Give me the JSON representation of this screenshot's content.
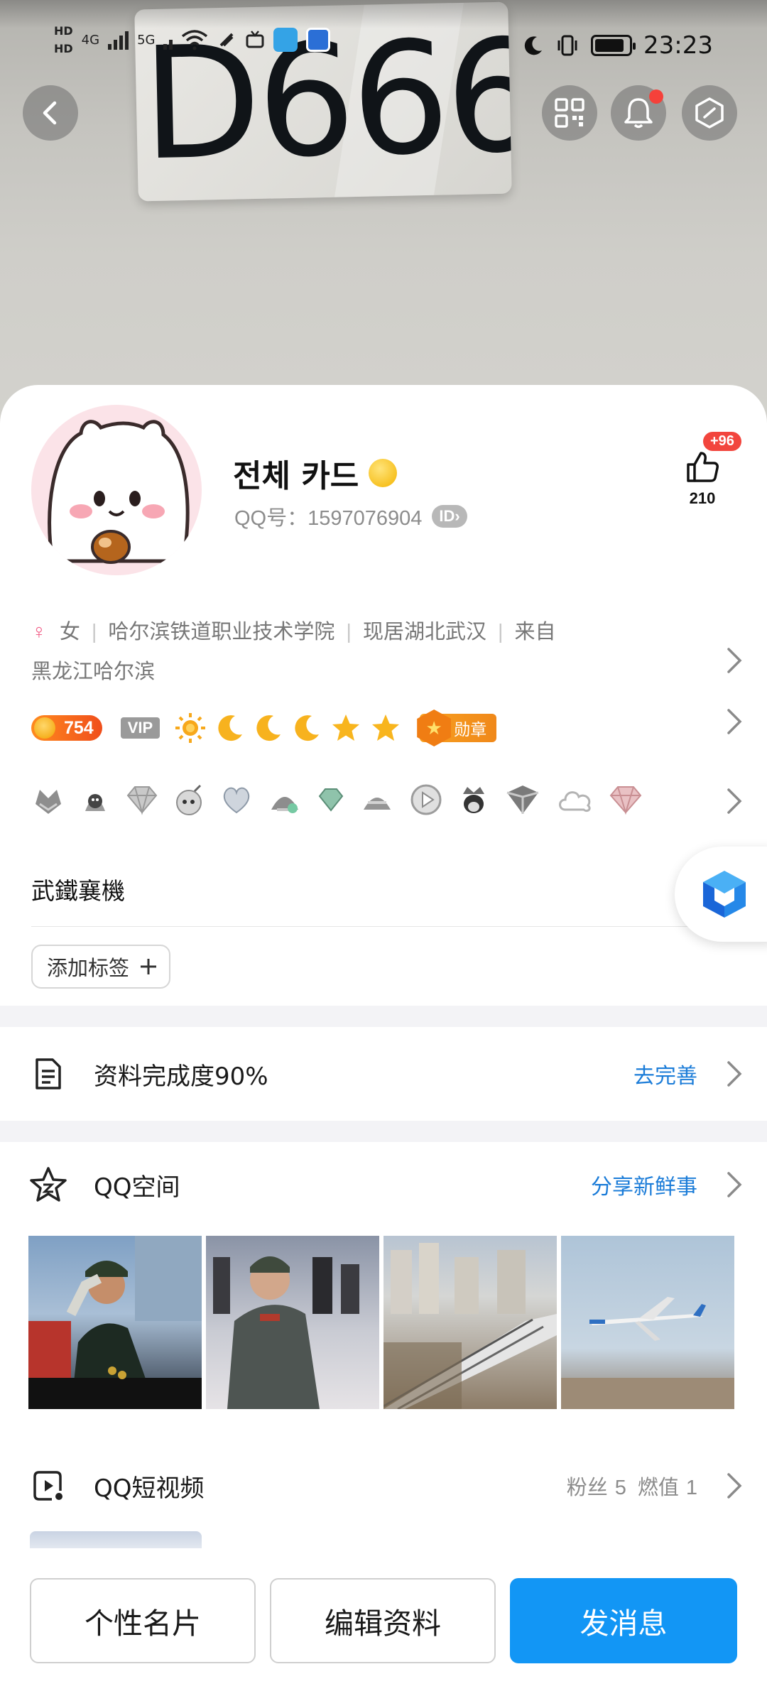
{
  "status_bar": {
    "hd1": "HD",
    "hd2": "HD",
    "net1": "4G",
    "net2": "5G",
    "time": "23:23"
  },
  "cover": {
    "plate_text": "D666"
  },
  "header_buttons": {
    "back": "back-arrow-icon",
    "qr": "qr-code-icon",
    "bell": "bell-icon",
    "settings": "hexagon-settings-icon"
  },
  "profile": {
    "name": "전체 카드",
    "qq_number": "QQ号：1597076904",
    "id_badge": "ID",
    "likes": "210",
    "likes_new": "+96",
    "gender": "女",
    "school": "哈尔滨铁道职业技术学院",
    "residence": "现居湖北武汉",
    "origin_prefix": "来自",
    "origin": "黑龙江哈尔滨",
    "level": "754",
    "vip": "VIP",
    "medal_label": "勋章",
    "signature": "武鐵襄機",
    "add_tag": "添加标签"
  },
  "completion": {
    "title": "资料完成度90%",
    "action": "去完善"
  },
  "qzone": {
    "title": "QQ空间",
    "action": "分享新鲜事"
  },
  "short_video": {
    "title": "QQ短视频",
    "fans_label": "粉丝",
    "fans": "5",
    "heat_label": "燃值",
    "heat": "1"
  },
  "bottom_bar": {
    "card": "个性名片",
    "edit": "编辑资料",
    "message": "发消息"
  },
  "colors": {
    "accent": "#1296f5",
    "link": "#1b7cd8",
    "badge_red": "#f2453d"
  }
}
